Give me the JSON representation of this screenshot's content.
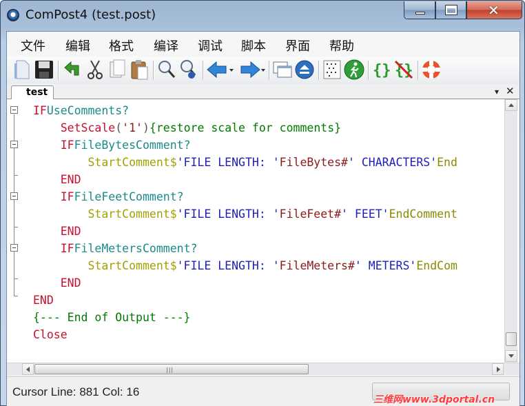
{
  "window": {
    "title": "ComPost4 (test.post)",
    "icon": "app-icon"
  },
  "menu": [
    "文件",
    "编辑",
    "格式",
    "编译",
    "调试",
    "脚本",
    "界面",
    "帮助"
  ],
  "toolbar": {
    "buttons": [
      "new-document-icon",
      "save-icon",
      "undo-icon",
      "cut-icon",
      "copy-icon",
      "paste-icon",
      "find-icon",
      "find-replace-icon",
      "back-arrow-icon",
      "forward-arrow-icon",
      "windows-icon",
      "collapse-icon",
      "grid-icon",
      "run-icon",
      "braces-icon",
      "braces-off-icon",
      "help-lifebuoy-icon"
    ]
  },
  "tabs": [
    {
      "label": "test",
      "active": true
    }
  ],
  "tabbar": {
    "menu_arrow": "▾",
    "close": "✕"
  },
  "editor": {
    "lines": [
      [
        [
          "kw",
          "IF"
        ],
        [
          "id",
          "UseComments?"
        ]
      ],
      [
        [
          "t",
          "    "
        ],
        [
          "kw",
          "SetScale"
        ],
        [
          "paren",
          "("
        ],
        [
          "var",
          "'1'"
        ],
        [
          "paren",
          ")"
        ],
        [
          "cm",
          "{restore scale for comments}"
        ]
      ],
      [
        [
          "t",
          "    "
        ],
        [
          "kw",
          "IF"
        ],
        [
          "id",
          "FileBytesComment?"
        ]
      ],
      [
        [
          "t",
          "        "
        ],
        [
          "fn",
          "StartComment$"
        ],
        [
          "str",
          "'FILE LENGTH: '"
        ],
        [
          "var",
          "FileBytes#"
        ],
        [
          "str",
          "' CHARACTERS'"
        ],
        [
          "fn2",
          "End"
        ]
      ],
      [
        [
          "t",
          "    "
        ],
        [
          "kw",
          "END"
        ]
      ],
      [
        [
          "t",
          "    "
        ],
        [
          "kw",
          "IF"
        ],
        [
          "id",
          "FileFeetComment?"
        ]
      ],
      [
        [
          "t",
          "        "
        ],
        [
          "fn",
          "StartComment$"
        ],
        [
          "str",
          "'FILE LENGTH: '"
        ],
        [
          "var",
          "FileFeet#"
        ],
        [
          "str",
          "' FEET'"
        ],
        [
          "fn2",
          "EndComment"
        ]
      ],
      [
        [
          "t",
          "    "
        ],
        [
          "kw",
          "END"
        ]
      ],
      [
        [
          "t",
          "    "
        ],
        [
          "kw",
          "IF"
        ],
        [
          "id",
          "FileMetersComment?"
        ]
      ],
      [
        [
          "t",
          "        "
        ],
        [
          "fn",
          "StartComment$"
        ],
        [
          "str",
          "'FILE LENGTH: '"
        ],
        [
          "var",
          "FileMeters#"
        ],
        [
          "str",
          "' METERS'"
        ],
        [
          "fn2",
          "EndCom"
        ]
      ],
      [
        [
          "t",
          "    "
        ],
        [
          "kw",
          "END"
        ]
      ],
      [
        [
          "kw",
          "END"
        ]
      ],
      [
        [
          "cm",
          "{--- End of Output ---}"
        ]
      ],
      [
        [
          "kw",
          "Close"
        ]
      ]
    ]
  },
  "status": {
    "text": "Cursor Line: 881 Col: 16",
    "watermark": "三维网www.3dportal.cn"
  },
  "colors": {
    "keyword": "#c8102e",
    "identifier": "#1a8a8a",
    "function": "#a0a000",
    "string": "#1d1db8",
    "variable": "#8b1a1a",
    "comment": "#007a00"
  }
}
